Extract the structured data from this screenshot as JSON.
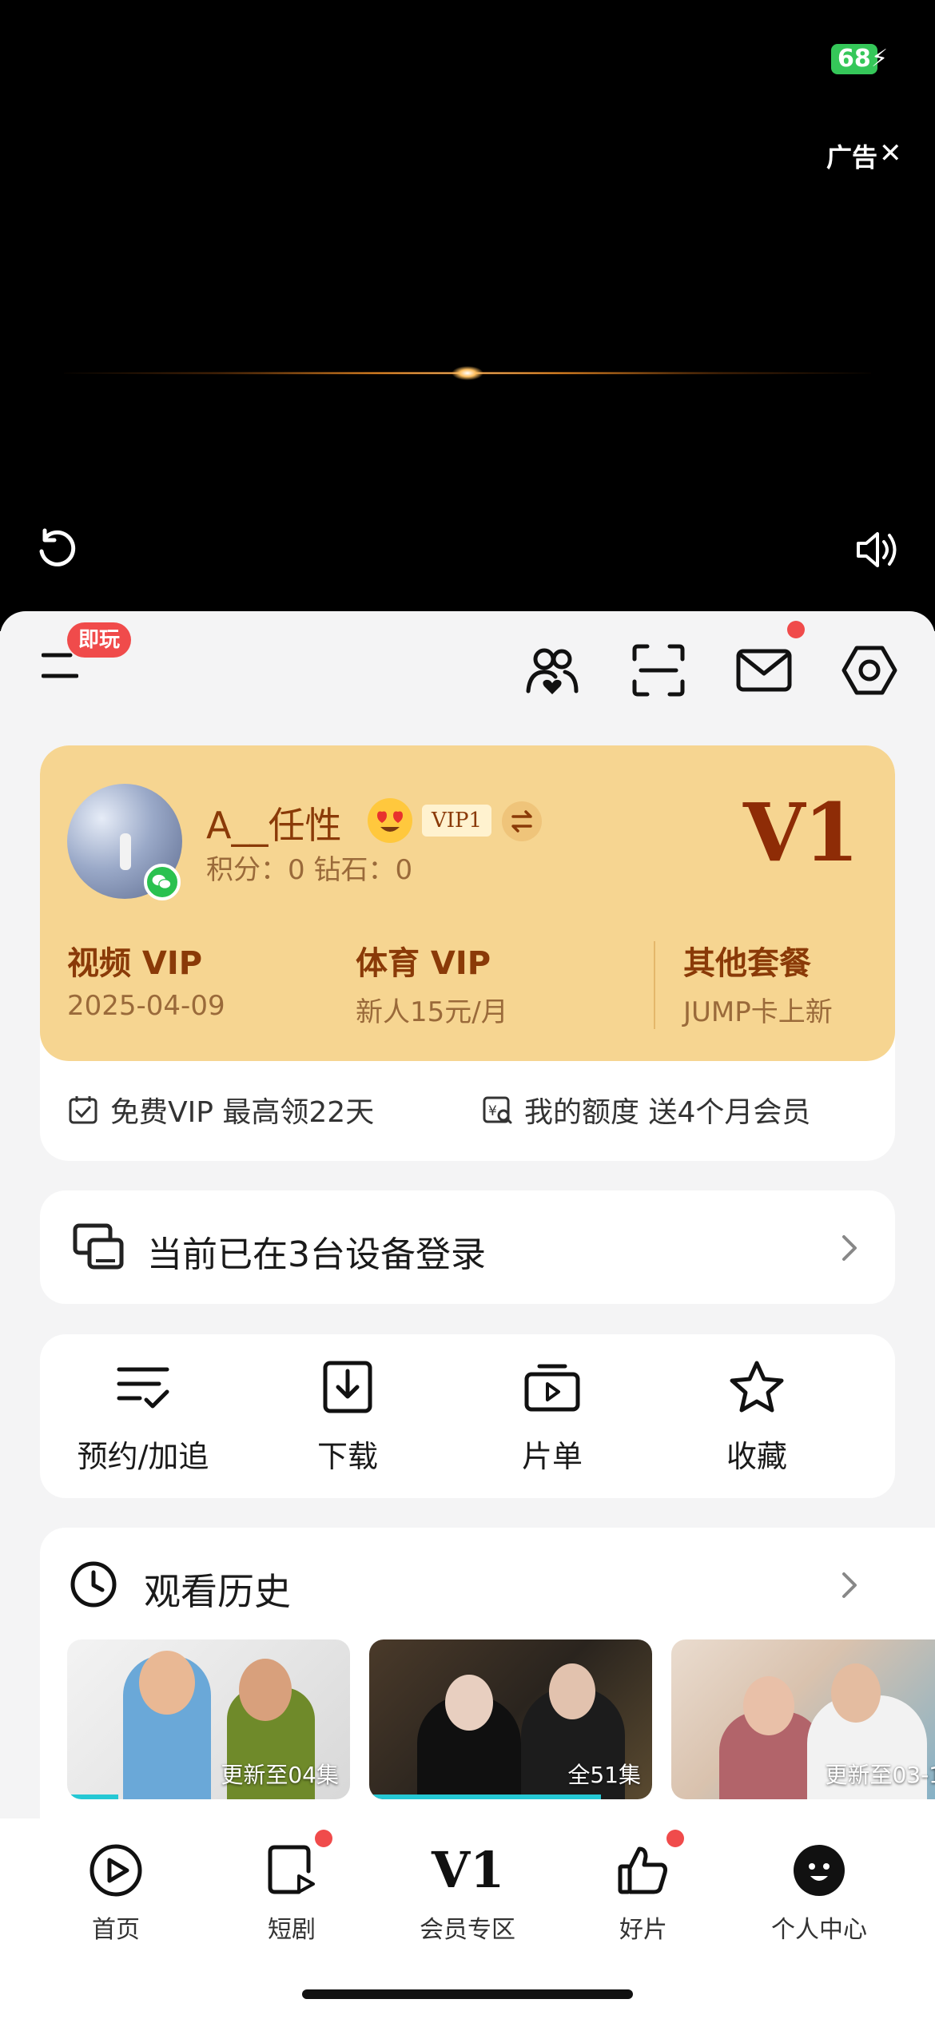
{
  "status": {
    "battery": "68"
  },
  "ad": {
    "label": "广告"
  },
  "topbar": {
    "badge": "即玩"
  },
  "member": {
    "username": "A__任性",
    "vip_tag": "VIP1",
    "points": "积分：0   钻石：0",
    "level_logo": "V1",
    "columns": [
      {
        "title": "视频 VIP",
        "sub": "2025-04-09"
      },
      {
        "title": "体育 VIP",
        "sub": "新人15元/月"
      },
      {
        "title": "其他套餐",
        "sub": "JUMP卡上新"
      }
    ],
    "perks": [
      {
        "text": "免费VIP 最高领22天"
      },
      {
        "text": "我的额度 送4个月会员"
      }
    ]
  },
  "devices": {
    "text": "当前已在3台设备登录"
  },
  "actions": [
    {
      "label": "预约/加追",
      "icon": "checklist-icon"
    },
    {
      "label": "下载",
      "icon": "download-icon"
    },
    {
      "label": "片单",
      "icon": "playlist-icon"
    },
    {
      "label": "收藏",
      "icon": "star-icon"
    }
  ],
  "history": {
    "title": "观看历史",
    "items": [
      {
        "label": "更新至04集",
        "progress": 0.18
      },
      {
        "label": "全51集",
        "progress": 0.82
      },
      {
        "label": "更新至03-1",
        "progress": 0.0
      }
    ]
  },
  "nav": [
    {
      "label": "首页",
      "icon": "home-play-icon"
    },
    {
      "label": "短剧",
      "icon": "short-drama-icon"
    },
    {
      "label": "会员专区",
      "icon": "v1-icon",
      "glyph": "V1"
    },
    {
      "label": "好片",
      "icon": "thumbs-up-icon"
    },
    {
      "label": "个人中心",
      "icon": "profile-icon"
    }
  ],
  "colors": {
    "accent": "#f6d591",
    "brand_text": "#8a3a08",
    "badge_red": "#f04b4b",
    "progress": "#25c8d4"
  }
}
